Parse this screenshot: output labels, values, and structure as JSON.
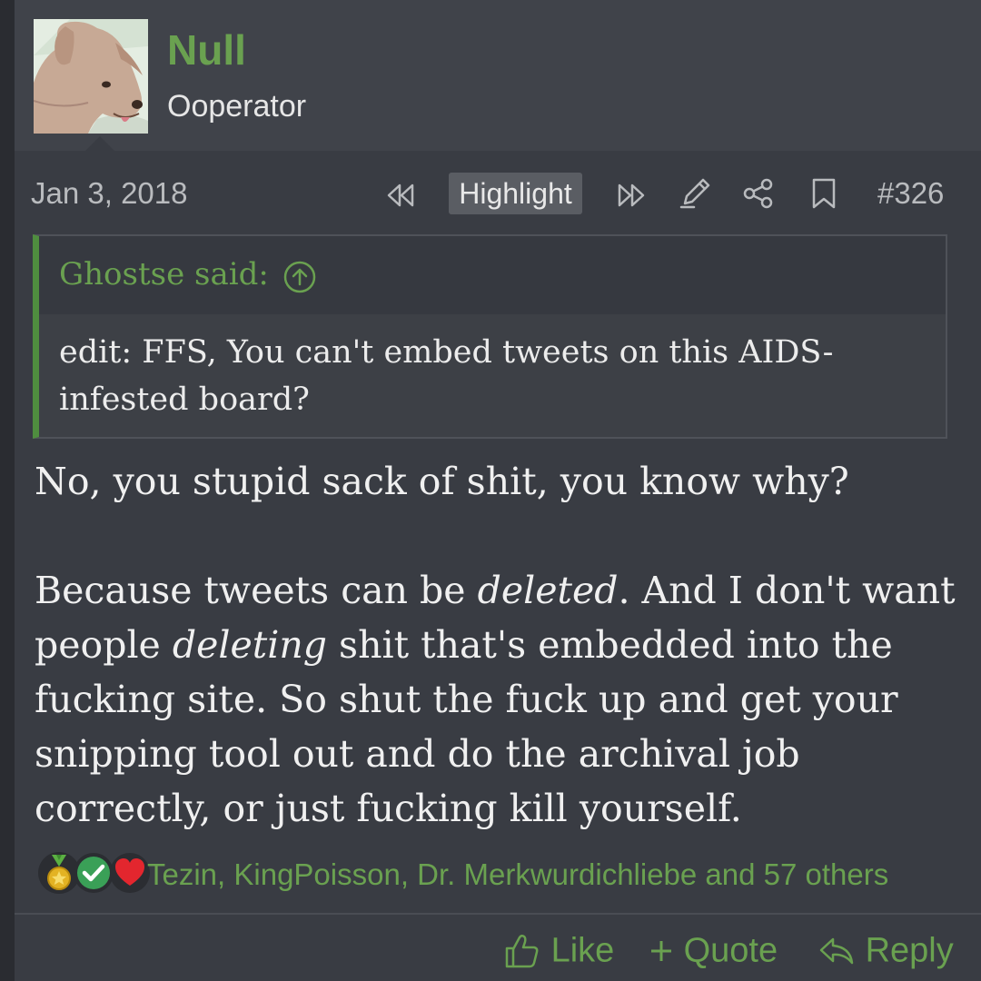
{
  "post": {
    "author": {
      "name": "Null",
      "title": "Ooperator"
    },
    "date": "Jan 3, 2018",
    "toolbar": {
      "prev_icon": "double-chevron-left-icon",
      "highlight_label": "Highlight",
      "next_icon": "double-chevron-right-icon",
      "edit_icon": "pencil-icon",
      "share_icon": "share-icon",
      "bookmark_icon": "bookmark-icon",
      "post_number": "#326"
    },
    "quote": {
      "author_line": "Ghostse said:",
      "text": "edit: FFS, You can't embed tweets on this AIDS-infested board?"
    },
    "body": {
      "p1": "No, you stupid sack of shit, you know why?",
      "p2_a": "Because tweets can be ",
      "p2_em1": "deleted",
      "p2_b": ". And I don't want people ",
      "p2_em2": "deleting",
      "p2_c": " shit that's embedded into the fucking site. So shut the fuck up and get your snipping tool out and do the archival job correctly, or just fucking kill yourself."
    },
    "reactions": {
      "icons": [
        "medal-icon",
        "checkmark-icon",
        "heart-icon"
      ],
      "reactors": "Tezin, KingPoisson, Dr. Merkwurdichliebe and 57 others"
    },
    "actions": {
      "like": "Like",
      "quote": "Quote",
      "reply": "Reply"
    }
  },
  "colors": {
    "accent_green": "#6aa150",
    "background": "#393c43",
    "header_background": "#40434a",
    "quote_border": "#4f8d3f"
  }
}
